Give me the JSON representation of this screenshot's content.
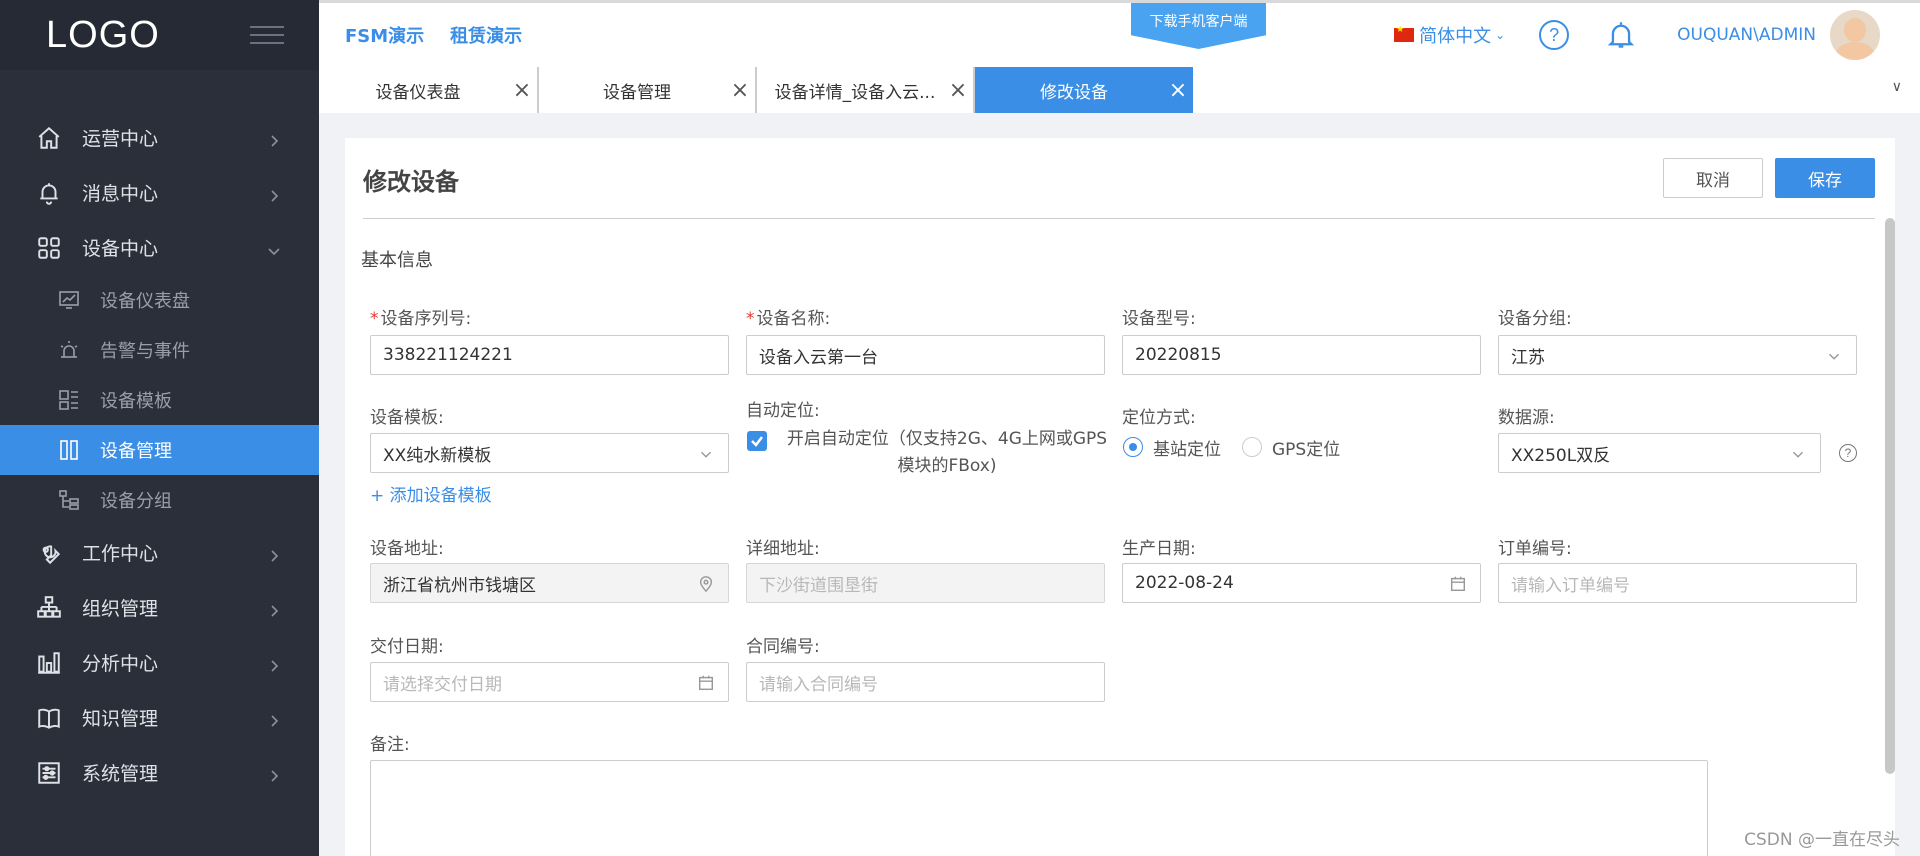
{
  "sidebar": {
    "logo": "LOGO",
    "items": [
      {
        "label": "运营中心",
        "icon": "home-icon"
      },
      {
        "label": "消息中心",
        "icon": "bell-icon"
      },
      {
        "label": "设备中心",
        "icon": "grid-icon"
      },
      {
        "label": "工作中心",
        "icon": "wrench-icon"
      },
      {
        "label": "组织管理",
        "icon": "org-chart-icon"
      },
      {
        "label": "分析中心",
        "icon": "bar-chart-icon"
      },
      {
        "label": "知识管理",
        "icon": "book-icon"
      },
      {
        "label": "系统管理",
        "icon": "settings-sliders-icon"
      }
    ],
    "sub_items": [
      {
        "label": "设备仪表盘",
        "icon": "dashboard-monitor-icon"
      },
      {
        "label": "告警与事件",
        "icon": "alarm-light-icon"
      },
      {
        "label": "设备模板",
        "icon": "template-icon"
      },
      {
        "label": "设备管理",
        "icon": "columns-icon"
      },
      {
        "label": "设备分组",
        "icon": "group-tree-icon"
      }
    ],
    "active_sub": "设备管理"
  },
  "header": {
    "links": [
      "FSM演示",
      "租赁演示"
    ],
    "download": "下载手机客户端",
    "language": "简体中文",
    "user": "OUQUAN\\ADMIN",
    "help": "?"
  },
  "tabs": [
    {
      "label": "设备仪表盘",
      "active": false
    },
    {
      "label": "设备管理",
      "active": false
    },
    {
      "label": "设备详情_设备入云...",
      "active": false
    },
    {
      "label": "修改设备",
      "active": true
    }
  ],
  "page": {
    "title": "修改设备",
    "cancel": "取消",
    "save": "保存",
    "section": "基本信息"
  },
  "form": {
    "serial": {
      "label": "设备序列号:",
      "value": "338221124221",
      "required": "*"
    },
    "name": {
      "label": "设备名称:",
      "value": "设备入云第一台",
      "required": "*"
    },
    "model": {
      "label": "设备型号:",
      "value": "20220815"
    },
    "group": {
      "label": "设备分组:",
      "value": "江苏"
    },
    "template": {
      "label": "设备模板:",
      "value": "XX纯水新模板",
      "add": "+ 添加设备模板"
    },
    "auto_locate": {
      "label": "自动定位:",
      "text_line1": "开启自动定位（仅支持2G、4G上网或GPS",
      "text_line2": "模块的FBox)",
      "checked": true
    },
    "locate_mode": {
      "label": "定位方式:",
      "options": [
        "基站定位",
        "GPS定位"
      ],
      "selected": "基站定位"
    },
    "datasource": {
      "label": "数据源:",
      "value": "XX250L双反"
    },
    "address": {
      "label": "设备地址:",
      "value": "浙江省杭州市钱塘区"
    },
    "detail_address": {
      "label": "详细地址:",
      "value": "下沙街道围垦街"
    },
    "production_date": {
      "label": "生产日期:",
      "value": "2022-08-24"
    },
    "order_no": {
      "label": "订单编号:",
      "placeholder": "请输入订单编号"
    },
    "delivery_date": {
      "label": "交付日期:",
      "placeholder": "请选择交付日期"
    },
    "contract_no": {
      "label": "合同编号:",
      "placeholder": "请输入合同编号"
    },
    "remark": {
      "label": "备注:"
    }
  },
  "watermark": "CSDN @一直在尽头",
  "colors": {
    "accent": "#3a8ee6",
    "sidebar": "#2b2f3a",
    "required": "#e53935"
  }
}
